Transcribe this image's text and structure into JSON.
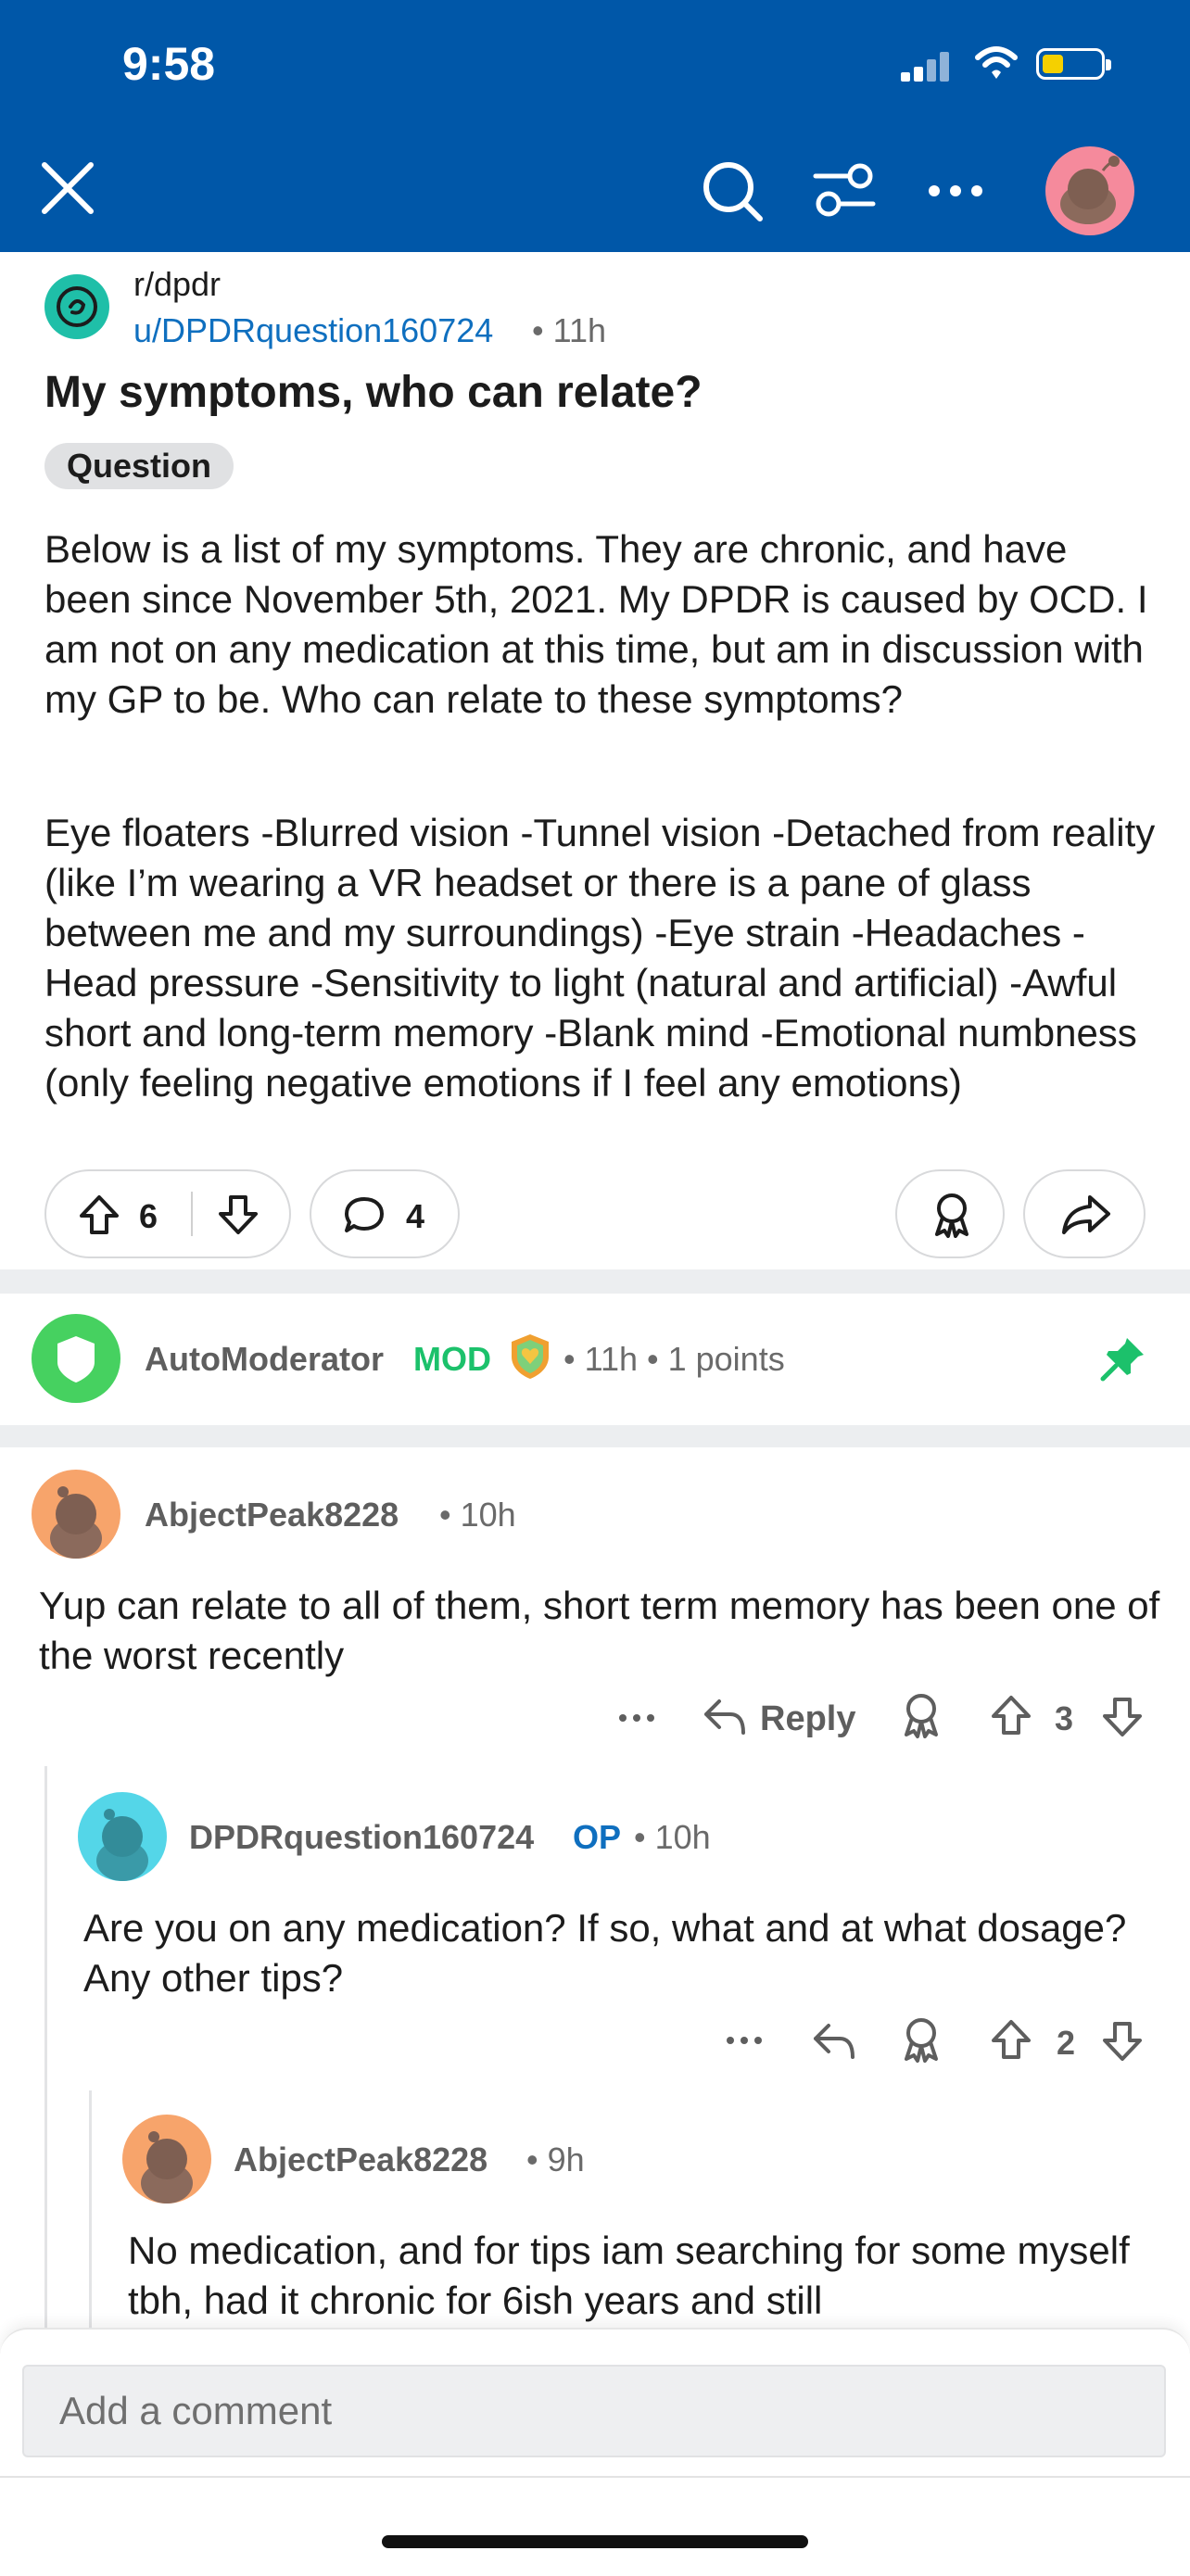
{
  "status_bar": {
    "time": "9:58"
  },
  "post": {
    "subreddit": "r/dpdr",
    "author": "u/DPDRquestion160724",
    "time": "• 11h",
    "title": "My symptoms, who can relate?",
    "flair": "Question",
    "paragraph1": "Below is a list of my symptoms. They are chronic, and have been since November 5th, 2021. My DPDR is caused by OCD. I am not on any medication at this time, but am in discussion with my GP to be. Who can relate to these symptoms?",
    "paragraph2": "Eye floaters -Blurred vision -Tunnel vision -Detached from reality (like I’m wearing a VR headset or there is a pane of glass between me and my surroundings) -Eye strain -Headaches -Head pressure -Sensitivity to light (natural and artificial) -Awful short and long-term memory -Blank mind -Emotional numbness (only feeling negative emotions if I feel any emotions)",
    "votes": "6",
    "comments": "4"
  },
  "mod_comment": {
    "author": "AutoModerator",
    "badge": "MOD",
    "meta": "• 11h • 1 points"
  },
  "comments": [
    {
      "author": "AbjectPeak8228",
      "time": "• 10h",
      "text": "Yup can relate to all of them, short term memory has been one of the worst recently",
      "reply_label": "Reply",
      "votes": "3"
    },
    {
      "author": "DPDRquestion160724",
      "badge": "OP",
      "time": "• 10h",
      "text": "Are you on any medication? If so, what and at what dosage? Any other tips?",
      "votes": "2"
    },
    {
      "author": "AbjectPeak8228",
      "time": "• 9h",
      "text": "No medication, and for tips iam searching for some myself tbh, had it chronic for 6ish years  and still"
    }
  ],
  "composer": {
    "placeholder": "Add a comment"
  },
  "colors": {
    "header": "#0057a8",
    "link": "#0f6fbf",
    "mod_green": "#1cc16b",
    "op_blue": "#0f6fbf"
  }
}
